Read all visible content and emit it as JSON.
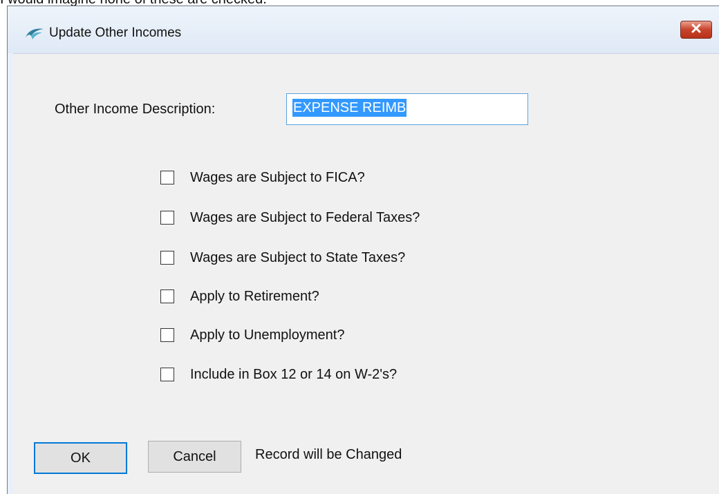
{
  "caption": "I would imagine none of these are checked.",
  "window": {
    "title": "Update Other Incomes",
    "icon": "bird-icon",
    "close_icon": "close-icon"
  },
  "form": {
    "description_label": "Other Income Description:",
    "description_value": "EXPENSE REIMB"
  },
  "checkboxes": [
    {
      "label": "Wages are Subject to FICA?",
      "checked": false
    },
    {
      "label": "Wages are Subject to Federal Taxes?",
      "checked": false
    },
    {
      "label": "Wages are Subject to State Taxes?",
      "checked": false
    },
    {
      "label": "Apply to Retirement?",
      "checked": false
    },
    {
      "label": "Apply to Unemployment?",
      "checked": false
    },
    {
      "label": "Include in Box 12 or 14 on W-2's?",
      "checked": false
    }
  ],
  "buttons": {
    "ok_label": "OK",
    "cancel_label": "Cancel"
  },
  "status_text": "Record will be Changed",
  "colors": {
    "selection": "#3399ff",
    "close_button": "#c8432b",
    "focus_border": "#0078d7"
  }
}
